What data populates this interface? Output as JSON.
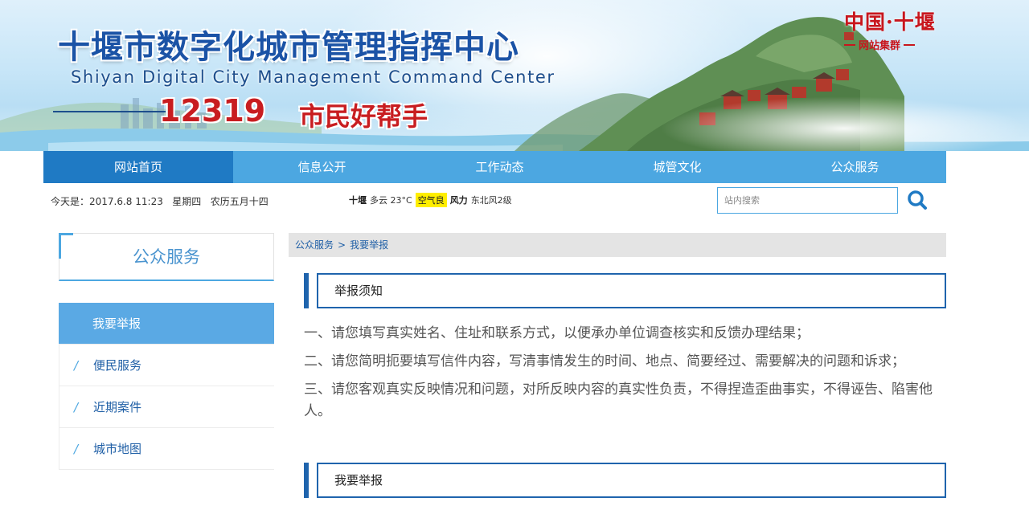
{
  "header": {
    "title": "十堰市数字化城市管理指挥中心",
    "subtitle": "Shiyan Digital City Management Command Center",
    "hotline_number": "12319",
    "hotline_slogan": "市民好帮手",
    "brand_main": "中国·十堰",
    "brand_sub": "网站集群"
  },
  "nav": {
    "items": [
      {
        "label": "网站首页",
        "active": true
      },
      {
        "label": "信息公开"
      },
      {
        "label": "工作动态"
      },
      {
        "label": "城管文化"
      },
      {
        "label": "公众服务"
      }
    ]
  },
  "info_bar": {
    "date_text": "今天是：2017.6.8 11:23   星期四   农历五月十四",
    "weather_city": "十堰",
    "weather_desc": "多云 23°C",
    "aqi_label": "空气良",
    "wind_label": "风力",
    "wind_desc": "东北风2级",
    "search_placeholder": "站内搜索"
  },
  "sidebar": {
    "title": "公众服务",
    "items": [
      {
        "label": "我要举报",
        "active": true
      },
      {
        "label": "便民服务"
      },
      {
        "label": "近期案件"
      },
      {
        "label": "城市地图"
      }
    ]
  },
  "breadcrumb": {
    "items": [
      "公众服务",
      "我要举报"
    ],
    "separator": ">"
  },
  "main": {
    "notice_title": "举报须知",
    "notice_items": [
      "一、请您填写真实姓名、住址和联系方式，以便承办单位调查核实和反馈办理结果；",
      "二、请您简明扼要填写信件内容，写清事情发生的时间、地点、简要经过、需要解决的问题和诉求；",
      "三、请您客观真实反映情况和问题，对所反映内容的真实性负责，不得捏造歪曲事实，不得诬告、陷害他人。"
    ],
    "report_title": "我要举报"
  },
  "colors": {
    "nav_bg": "#4ca7e1",
    "nav_active": "#1f7ac4",
    "title_blue": "#1b53a6",
    "slogan_red": "#c81d20",
    "section_border": "#1f64ad",
    "sidebar_active": "#5aa9e4"
  },
  "icons": {
    "search": "search-icon"
  }
}
